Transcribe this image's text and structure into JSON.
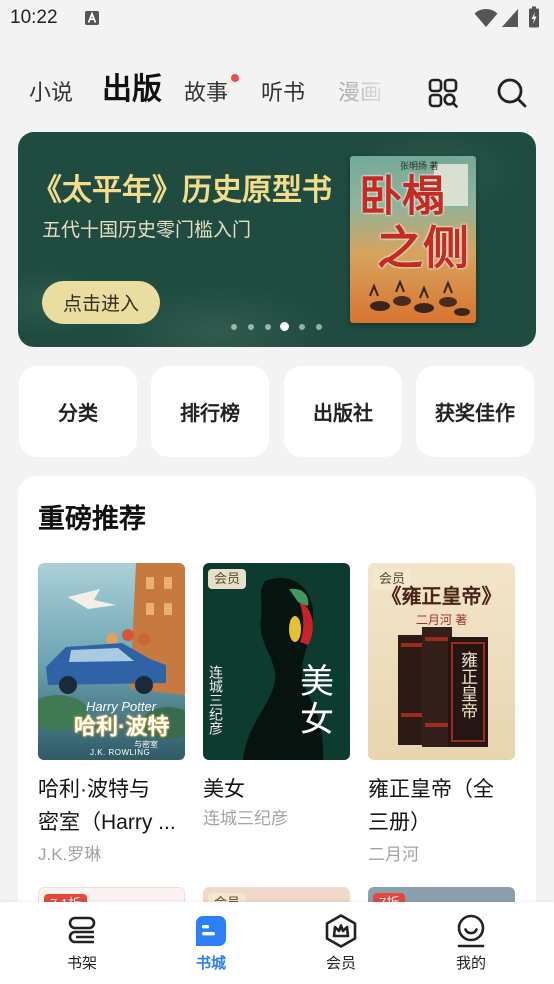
{
  "status_bar": {
    "time": "10:22",
    "icons": [
      "a-notification-icon",
      "wifi-icon",
      "signal-icon",
      "battery-charging-icon"
    ]
  },
  "top_tabs": [
    {
      "label": "小说",
      "active": false
    },
    {
      "label": "出版",
      "active": true
    },
    {
      "label": "故事",
      "active": false,
      "red_dot": true
    },
    {
      "label": "听书",
      "active": false
    },
    {
      "label": "漫画",
      "active": false
    }
  ],
  "top_actions": {
    "grid_icon": "grid-search-icon",
    "search_icon": "search-icon"
  },
  "banner": {
    "title": "《太平年》历史原型书",
    "subtitle": "五代十国历史零门槛入门",
    "button_label": "点击进入",
    "book": {
      "title_line1": "卧榻",
      "title_line2": "之侧",
      "author": "张明扬 著"
    },
    "carousel": {
      "count": 6,
      "active_index": 3
    }
  },
  "quick_links": [
    {
      "label": "分类"
    },
    {
      "label": "排行榜"
    },
    {
      "label": "出版社"
    },
    {
      "label": "获奖佳作"
    }
  ],
  "recommend": {
    "title": "重磅推荐",
    "books": [
      {
        "title_lines": [
          "哈利·波特与",
          "密室（Harry ..."
        ],
        "author": "J.K.罗琳",
        "cover": {
          "en_title": "Harry Potter",
          "cn_title": "哈利·波特",
          "subtitle": "与密室",
          "author": "J.K. ROWLING"
        }
      },
      {
        "title_lines": [
          "美女"
        ],
        "author": "连城三纪彦",
        "badge": "会员",
        "cover": {
          "title": "美女",
          "author": "连城三纪彦"
        }
      },
      {
        "title_lines": [
          "雍正皇帝（全",
          "三册）"
        ],
        "author": "二月河",
        "badge": "会员",
        "cover": {
          "title": "《雍正皇帝》",
          "author": "二月河 著",
          "spine_title": "雍正皇帝"
        }
      }
    ],
    "next_row": [
      {
        "badge": "7.1折"
      },
      {
        "badge": "会员"
      },
      {
        "badge": "7折"
      }
    ]
  },
  "bottom_nav": [
    {
      "label": "书架",
      "icon": "bookshelf-icon",
      "active": false
    },
    {
      "label": "书城",
      "icon": "bookstore-icon",
      "active": true
    },
    {
      "label": "会员",
      "icon": "vip-crown-icon",
      "active": false
    },
    {
      "label": "我的",
      "icon": "profile-icon",
      "active": false
    }
  ],
  "colors": {
    "accent": "#2d7ff9",
    "banner_bg": "#1f4b40",
    "banner_title": "#f3dc8a",
    "badge_red": "#e8453c",
    "dot_red": "#f04b4b"
  }
}
